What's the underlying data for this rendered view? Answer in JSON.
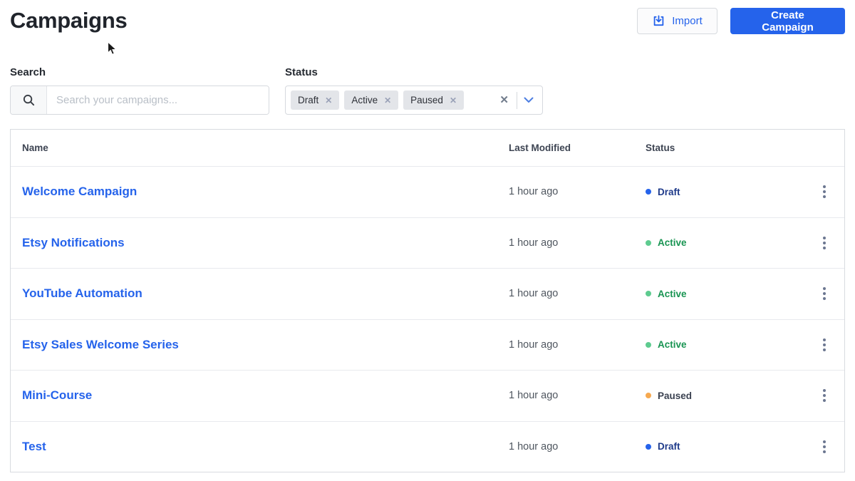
{
  "page": {
    "title": "Campaigns"
  },
  "header": {
    "import_label": "Import",
    "create_label": "Create Campaign"
  },
  "filters": {
    "search_label": "Search",
    "search_placeholder": "Search your campaigns...",
    "status_label": "Status",
    "status_chips": [
      {
        "label": "Draft"
      },
      {
        "label": "Active"
      },
      {
        "label": "Paused"
      }
    ]
  },
  "table": {
    "columns": [
      "Name",
      "Last Modified",
      "Status"
    ],
    "rows": [
      {
        "name": "Welcome Campaign",
        "last_modified": "1 hour ago",
        "status": "Draft"
      },
      {
        "name": "Etsy Notifications",
        "last_modified": "1 hour ago",
        "status": "Active"
      },
      {
        "name": "YouTube Automation",
        "last_modified": "1 hour ago",
        "status": "Active"
      },
      {
        "name": "Etsy Sales Welcome Series",
        "last_modified": "1 hour ago",
        "status": "Active"
      },
      {
        "name": "Mini-Course",
        "last_modified": "1 hour ago",
        "status": "Paused"
      },
      {
        "name": "Test",
        "last_modified": "1 hour ago",
        "status": "Draft"
      }
    ]
  },
  "colors": {
    "accent_blue": "#2563eb",
    "status": {
      "Draft": {
        "dot": "#2563eb",
        "text": "#1e3a8a"
      },
      "Active": {
        "dot": "#5ecb8f",
        "text": "#189452"
      },
      "Paused": {
        "dot": "#f6a950",
        "text": "#3a4150"
      }
    }
  }
}
